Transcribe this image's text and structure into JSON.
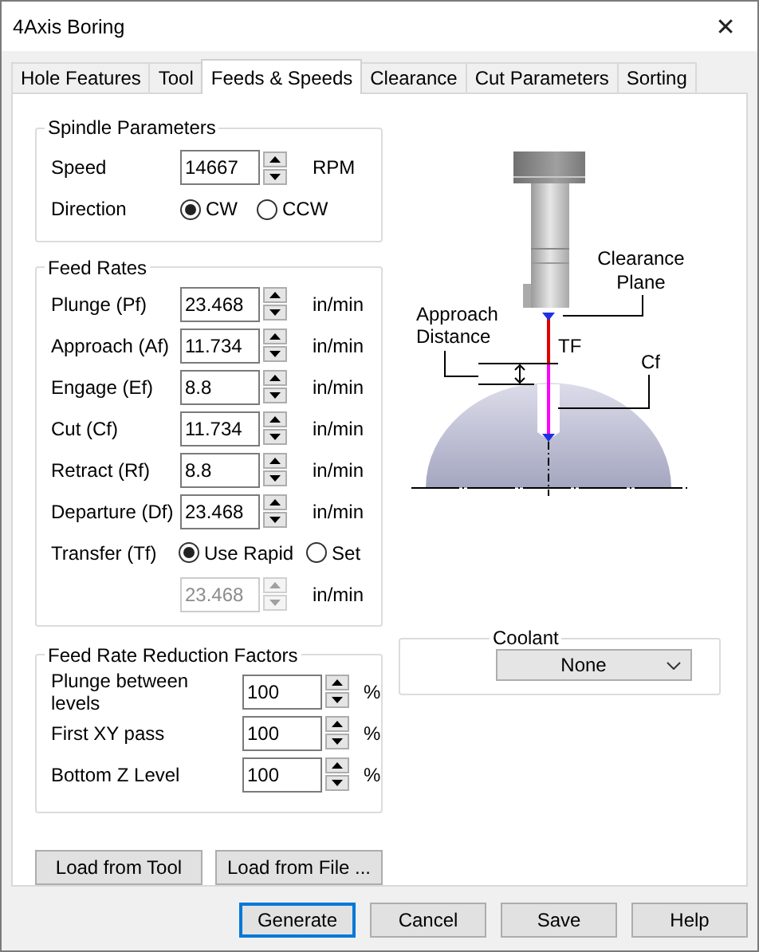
{
  "window": {
    "title": "4Axis Boring",
    "close": "✕"
  },
  "tabs": [
    {
      "label": "Hole Features",
      "selected": false
    },
    {
      "label": "Tool",
      "selected": false
    },
    {
      "label": "Feeds & Speeds",
      "selected": true
    },
    {
      "label": "Clearance",
      "selected": false
    },
    {
      "label": "Cut Parameters",
      "selected": false
    },
    {
      "label": "Sorting",
      "selected": false
    }
  ],
  "spindle": {
    "title": "Spindle Parameters",
    "speed": {
      "label": "Speed",
      "value": "14667",
      "unit": "RPM"
    },
    "direction": {
      "label": "Direction",
      "options": [
        {
          "label": "CW",
          "selected": true
        },
        {
          "label": "CCW",
          "selected": false
        }
      ]
    }
  },
  "feed_rates": {
    "title": "Feed Rates",
    "rows": [
      {
        "label": "Plunge (Pf)",
        "value": "23.468",
        "unit": "in/min"
      },
      {
        "label": "Approach (Af)",
        "value": "11.734",
        "unit": "in/min"
      },
      {
        "label": "Engage (Ef)",
        "value": "8.8",
        "unit": "in/min"
      },
      {
        "label": "Cut (Cf)",
        "value": "11.734",
        "unit": "in/min"
      },
      {
        "label": "Retract (Rf)",
        "value": "8.8",
        "unit": "in/min"
      },
      {
        "label": "Departure  (Df)",
        "value": "23.468",
        "unit": "in/min"
      }
    ],
    "transfer": {
      "label": "Transfer (Tf)",
      "options": [
        {
          "label": "Use Rapid",
          "selected": true
        },
        {
          "label": "Set",
          "selected": false
        }
      ],
      "value": "23.468",
      "unit": "in/min",
      "disabled": true
    }
  },
  "reduction": {
    "title": "Feed Rate Reduction Factors",
    "rows": [
      {
        "label": "Plunge between levels",
        "value": "100",
        "unit": "%"
      },
      {
        "label": "First XY pass",
        "value": "100",
        "unit": "%"
      },
      {
        "label": "Bottom Z Level",
        "value": "100",
        "unit": "%"
      }
    ]
  },
  "diagram": {
    "clearance_label": [
      "Clearance",
      "Plane"
    ],
    "tf_label": "TF",
    "cf_label": "Cf",
    "approach_label": [
      "Approach",
      "Distance"
    ]
  },
  "coolant": {
    "title": "Coolant",
    "value": "None"
  },
  "load_buttons": [
    "Load from Tool",
    "Load from File ..."
  ],
  "buttons": [
    {
      "label": "Generate",
      "default": true
    },
    {
      "label": "Cancel",
      "default": false
    },
    {
      "label": "Save",
      "default": false
    },
    {
      "label": "Help",
      "default": false
    }
  ]
}
